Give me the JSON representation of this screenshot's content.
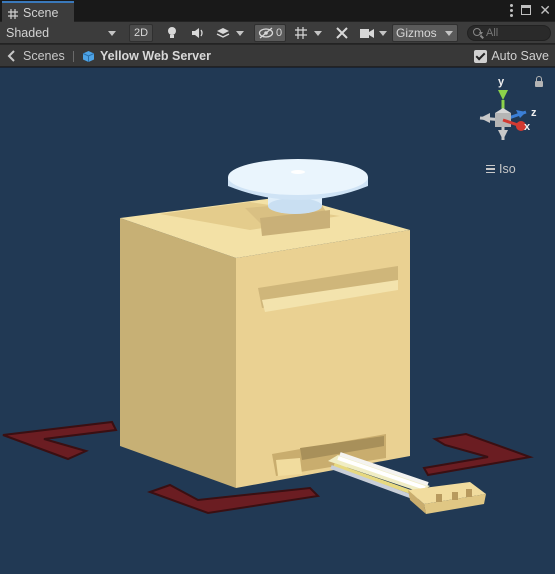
{
  "window": {
    "tab_title": "Scene"
  },
  "toolbar": {
    "shading_mode": "Shaded",
    "mode_2d_label": "2D",
    "hidden_count": "0",
    "gizmos_label": "Gizmos",
    "search_placeholder": "All"
  },
  "breadcrumb": {
    "root_label": "Scenes",
    "current_label": "Yellow Web Server"
  },
  "autosave": {
    "label": "Auto Save",
    "checked": true
  },
  "orientation_gizmo": {
    "y_label": "y",
    "z_label": "z",
    "x_label": "x",
    "projection_label": "Iso"
  },
  "colors": {
    "viewport_background": "#213954",
    "tab_accent": "#3a79bb",
    "model_body": "#ecd496",
    "axis_y": "#8cd14a",
    "axis_x": "#d23a32",
    "axis_z": "#3b7fd6"
  }
}
